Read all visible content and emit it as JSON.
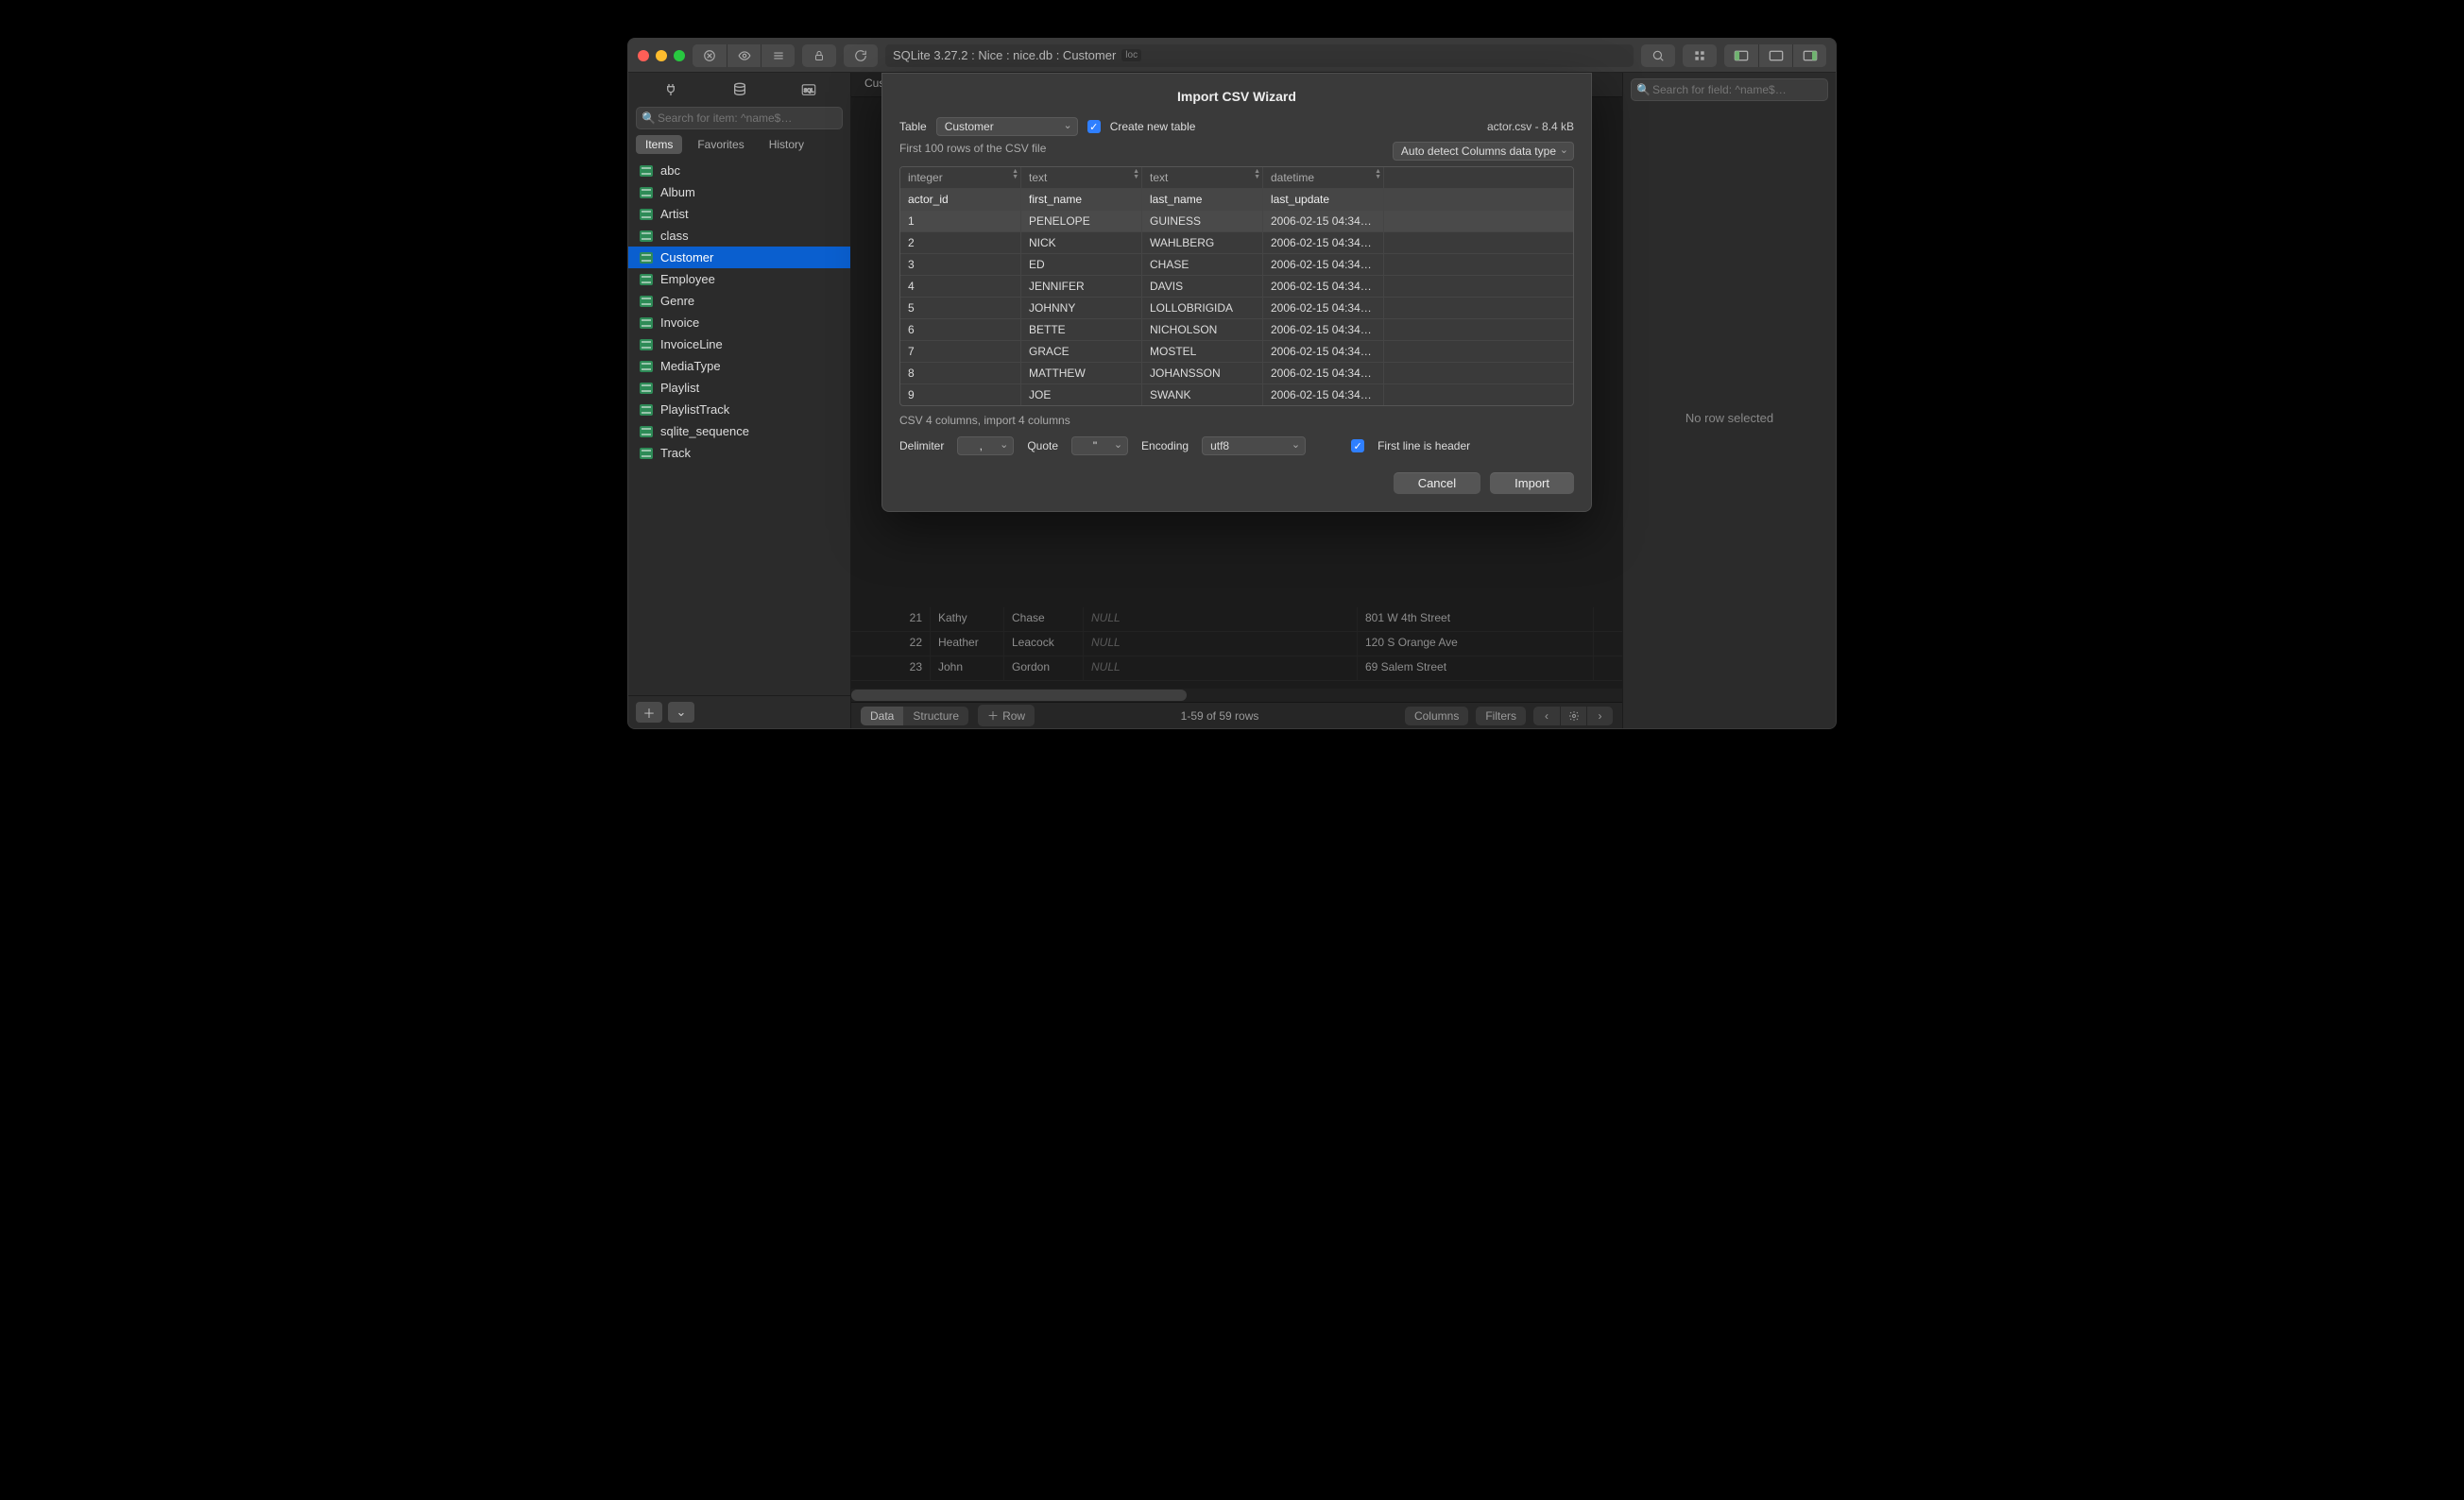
{
  "titlebar": {
    "path": "SQLite 3.27.2 : Nice : nice.db : Customer",
    "loc_badge": "loc"
  },
  "sidebar": {
    "search_placeholder": "Search for item: ^name$…",
    "tabs": [
      "Items",
      "Favorites",
      "History"
    ],
    "active_tab_index": 0,
    "items": [
      "abc",
      "Album",
      "Artist",
      "class",
      "Customer",
      "Employee",
      "Genre",
      "Invoice",
      "InvoiceLine",
      "MediaType",
      "Playlist",
      "PlaylistTrack",
      "sqlite_sequence",
      "Track"
    ],
    "selected_item_index": 4
  },
  "center": {
    "tab_label": "Customer",
    "background_rows": [
      {
        "id": "21",
        "fn": "Kathy",
        "ln": "Chase",
        "cm": "NULL",
        "ad": "801 W 4th Street"
      },
      {
        "id": "22",
        "fn": "Heather",
        "ln": "Leacock",
        "cm": "NULL",
        "ad": "120 S Orange Ave"
      },
      {
        "id": "23",
        "fn": "John",
        "ln": "Gordon",
        "cm": "NULL",
        "ad": "69 Salem Street"
      }
    ],
    "footer": {
      "mode_options": [
        "Data",
        "Structure"
      ],
      "mode_active_index": 0,
      "row_label": "Row",
      "pagination": "1-59 of 59 rows",
      "columns_btn": "Columns",
      "filters_btn": "Filters"
    }
  },
  "right": {
    "search_placeholder": "Search for field: ^name$…",
    "empty_text": "No row selected"
  },
  "dialog": {
    "title": "Import CSV Wizard",
    "table_label": "Table",
    "table_value": "Customer",
    "create_new_label": "Create new table",
    "file_info": "actor.csv  -  8.4 kB",
    "first_rows_label": "First 100 rows of the CSV file",
    "autodetect_label": "Auto detect Columns data type",
    "col_types": [
      "integer",
      "text",
      "text",
      "datetime",
      ""
    ],
    "col_headers": [
      "actor_id",
      "first_name",
      "last_name",
      "last_update",
      ""
    ],
    "rows": [
      [
        "1",
        "PENELOPE",
        "GUINESS",
        "2006-02-15 04:34…",
        ""
      ],
      [
        "2",
        "NICK",
        "WAHLBERG",
        "2006-02-15 04:34…",
        ""
      ],
      [
        "3",
        "ED",
        "CHASE",
        "2006-02-15 04:34…",
        ""
      ],
      [
        "4",
        "JENNIFER",
        "DAVIS",
        "2006-02-15 04:34…",
        ""
      ],
      [
        "5",
        "JOHNNY",
        "LOLLOBRIGIDA",
        "2006-02-15 04:34…",
        ""
      ],
      [
        "6",
        "BETTE",
        "NICHOLSON",
        "2006-02-15 04:34…",
        ""
      ],
      [
        "7",
        "GRACE",
        "MOSTEL",
        "2006-02-15 04:34…",
        ""
      ],
      [
        "8",
        "MATTHEW",
        "JOHANSSON",
        "2006-02-15 04:34…",
        ""
      ],
      [
        "9",
        "JOE",
        "SWANK",
        "2006-02-15 04:34…",
        ""
      ]
    ],
    "columns_note": "CSV 4 columns, import 4 columns",
    "delimiter_label": "Delimiter",
    "delimiter_value": ",",
    "quote_label": "Quote",
    "quote_value": "\"",
    "encoding_label": "Encoding",
    "encoding_value": "utf8",
    "first_line_header_label": "First line is header",
    "cancel_label": "Cancel",
    "import_label": "Import"
  }
}
